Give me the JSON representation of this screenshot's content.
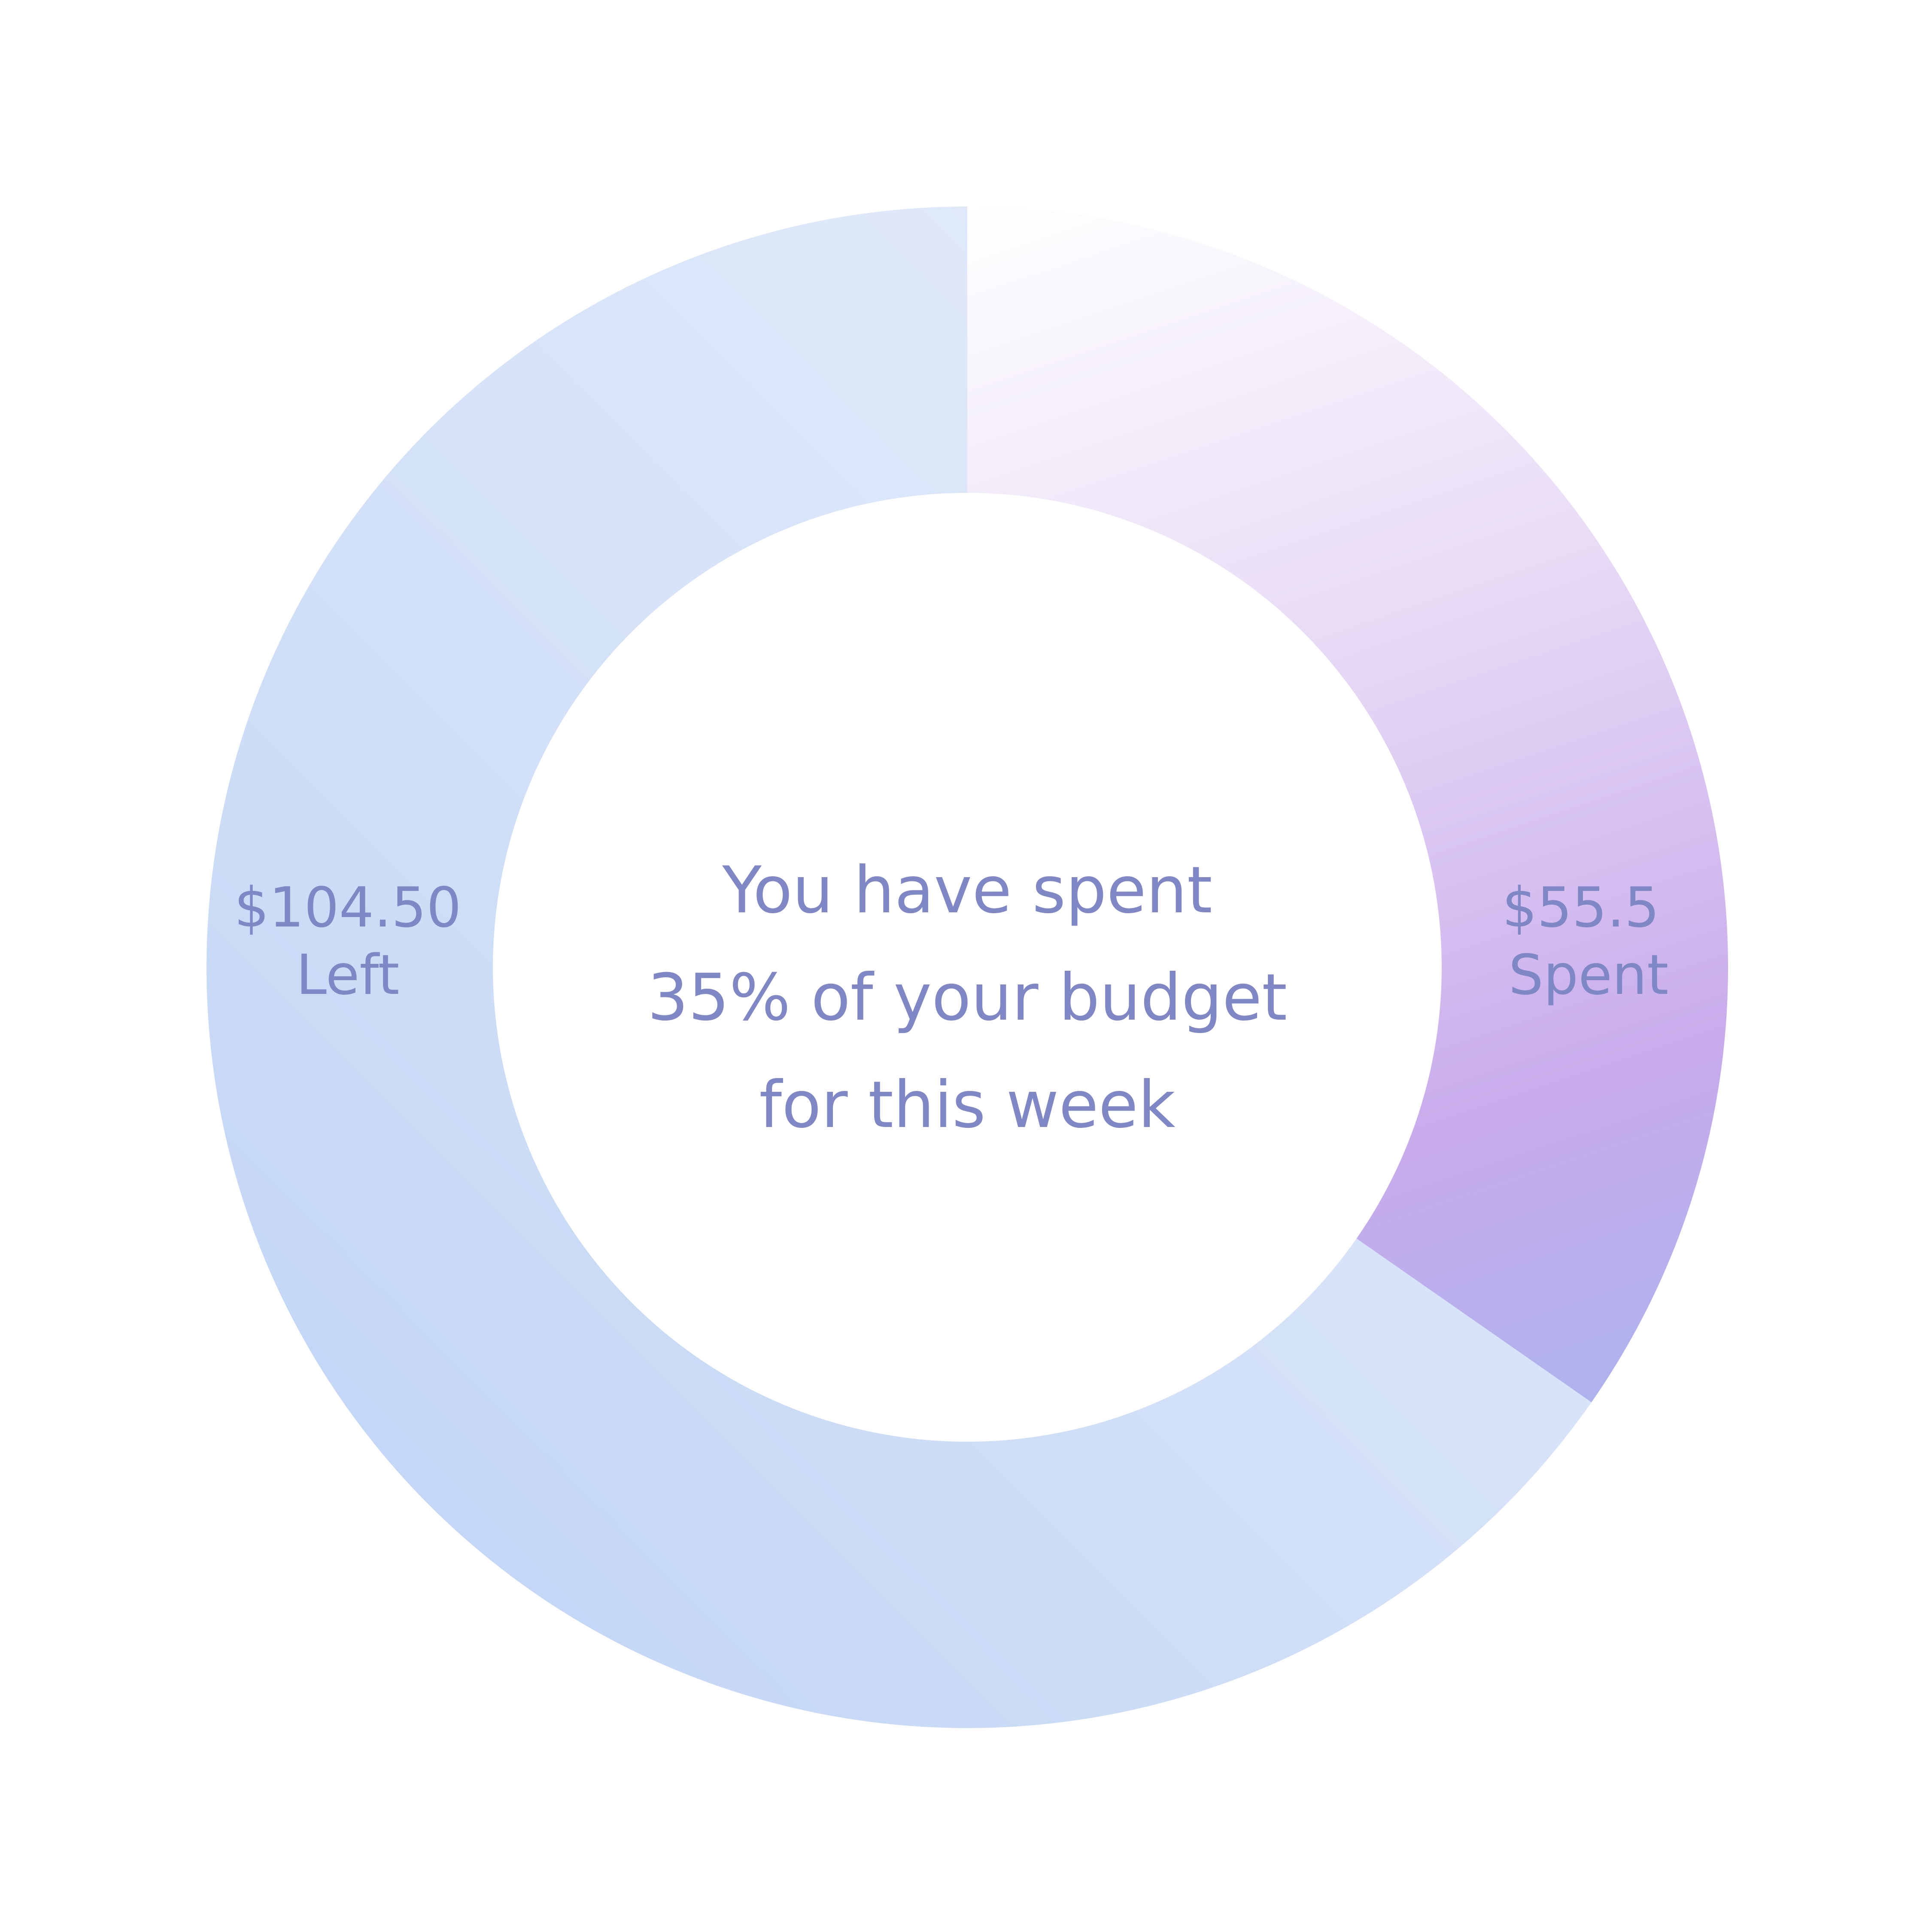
{
  "chart_data": {
    "type": "pie",
    "style": "donut",
    "slices": [
      {
        "label": "Spent",
        "amount_text": "$55.5",
        "value": 55.5,
        "percent": 35
      },
      {
        "label": "Left",
        "amount_text": "$104.50",
        "value": 104.5,
        "percent": 65
      }
    ],
    "center_text": [
      "You have spent",
      "35% of your budget",
      "for this week"
    ]
  },
  "colors": {
    "text": "#7F88C4",
    "spent_gradient": [
      "#FFFFFF",
      "#E9DDF6",
      "#C8ABEC",
      "#A5B5EE"
    ],
    "left_gradient": [
      "#E2EBFA",
      "#D3E1F8",
      "#C1D5F5"
    ]
  }
}
